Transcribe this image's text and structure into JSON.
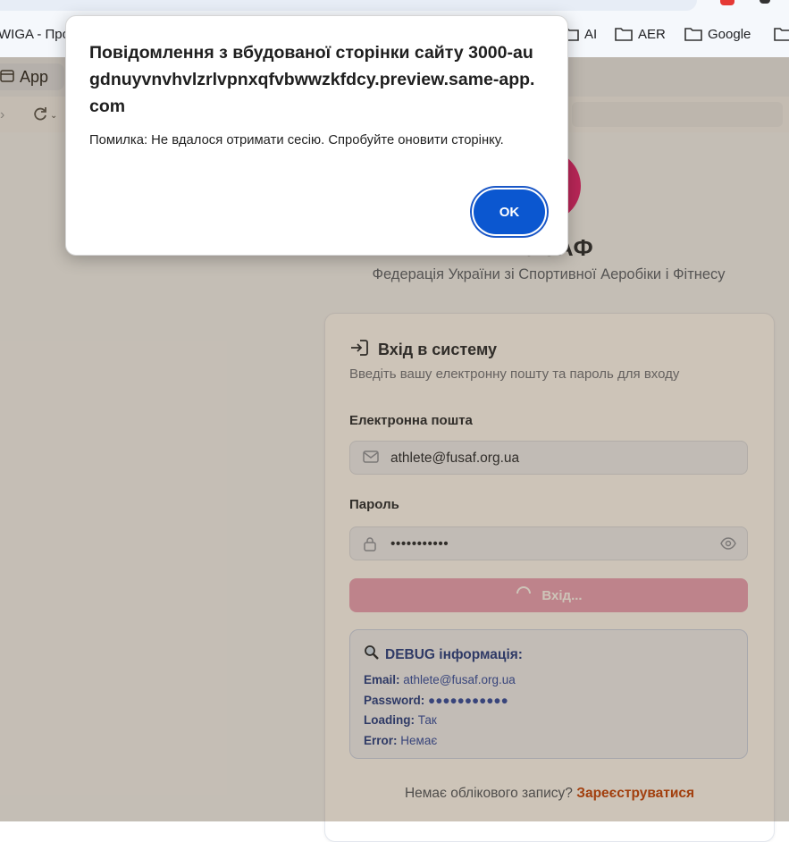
{
  "bookmarks": [
    {
      "label": "WIGA - Про",
      "icon": "page-icon"
    },
    {
      "label": "AI",
      "icon": "folder-icon"
    },
    {
      "label": "AER",
      "icon": "folder-icon"
    },
    {
      "label": "Google",
      "icon": "folder-icon"
    }
  ],
  "tab": {
    "label": "App",
    "icon": "app-window-icon"
  },
  "page": {
    "brand": "ФУСАФ",
    "subtitle": "Федерація України зі Спортивної Аеробіки і Фітнесу",
    "login": {
      "title": "Вхід в систему",
      "description": "Введіть вашу електронну пошту та пароль для входу",
      "email_label": "Електронна пошта",
      "email_value": "athlete@fusaf.org.ua",
      "password_label": "Пароль",
      "password_value": "•••••••••••",
      "submit_label": "Вхід..."
    },
    "debug": {
      "title": "DEBUG інформація:",
      "email_key": "Email:",
      "email_value": "athlete@fusaf.org.ua",
      "password_key": "Password:",
      "password_value": "●●●●●●●●●●●",
      "loading_key": "Loading:",
      "loading_value": "Так",
      "error_key": "Error:",
      "error_value": "Немає"
    },
    "signup": {
      "prompt": "Немає облікового запису?",
      "link": "Зареєструватися"
    }
  },
  "dialog": {
    "title": "Повідомлення з вбудованої сторінки сайту 3000-augdnuyvnvhvlzrlvpnxqfvbwwzkfdcy.preview.same-app.com",
    "message": "Помилка: Не вдалося отримати сесію. Спробуйте оновити сторінку.",
    "ok_label": "OK"
  },
  "colors": {
    "brand_pink": "#e11d74",
    "button_disabled": "#eaa3bf",
    "link_orange": "#c2410c",
    "ok_blue": "#0b57d0"
  }
}
